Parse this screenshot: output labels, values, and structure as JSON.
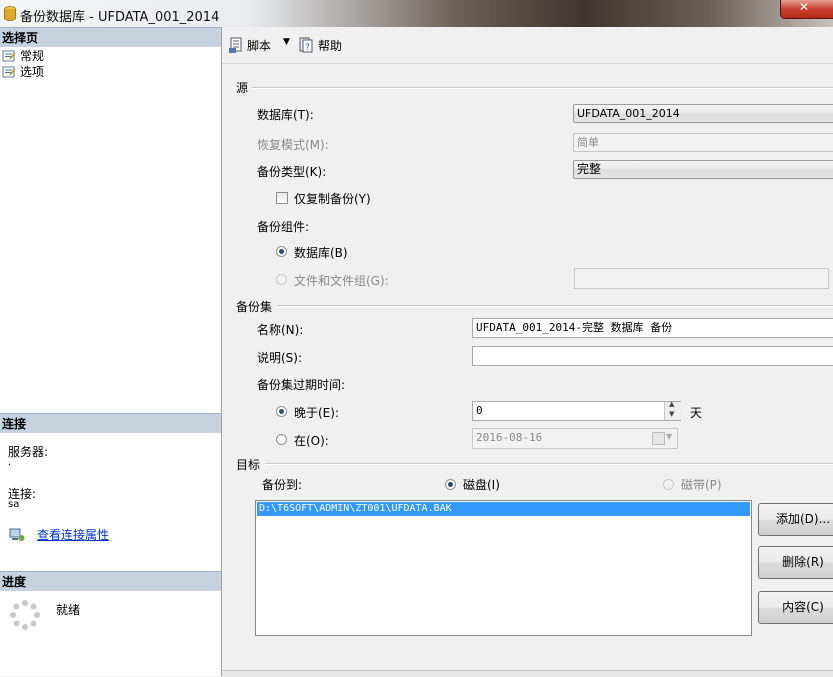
{
  "window": {
    "title": "备份数据库 - UFDATA_001_2014"
  },
  "left": {
    "select_page_header": "选择页",
    "pages": [
      "常规",
      "选项"
    ],
    "connection_header": "连接",
    "server_label": "服务器:",
    "server_value": ".",
    "connection_label": "连接:",
    "connection_value": "sa",
    "view_conn_props": "查看连接属性",
    "progress_header": "进度",
    "progress_status": "就绪"
  },
  "toolbar": {
    "script": "脚本",
    "help": "帮助"
  },
  "source": {
    "group": "源",
    "database_label": "数据库(T):",
    "database_value": "UFDATA_001_2014",
    "recovery_label": "恢复模式(M):",
    "recovery_value": "简单",
    "backup_type_label": "备份类型(K):",
    "backup_type_value": "完整",
    "copy_only_label": "仅复制备份(Y)",
    "component_label": "备份组件:",
    "component_database": "数据库(B)",
    "component_files": "文件和文件组(G):",
    "files_value": ""
  },
  "backup_set": {
    "group": "备份集",
    "name_label": "名称(N):",
    "name_value": "UFDATA_001_2014-完整 数据库 备份",
    "desc_label": "说明(S):",
    "desc_value": "",
    "expire_label": "备份集过期时间:",
    "after_label": "晚于(E):",
    "after_value": "0",
    "days_label": "天",
    "on_label": "在(O):",
    "on_value": "2016-08-16"
  },
  "destination": {
    "group": "目标",
    "backup_to_label": "备份到:",
    "disk_label": "磁盘(I)",
    "tape_label": "磁带(P)",
    "paths": [
      "D:\\T6SOFT\\ADMIN\\ZT001\\UFDATA.BAK"
    ],
    "add_button": "添加(D)...",
    "remove_button": "删除(R)",
    "contents_button": "内容(C)"
  }
}
